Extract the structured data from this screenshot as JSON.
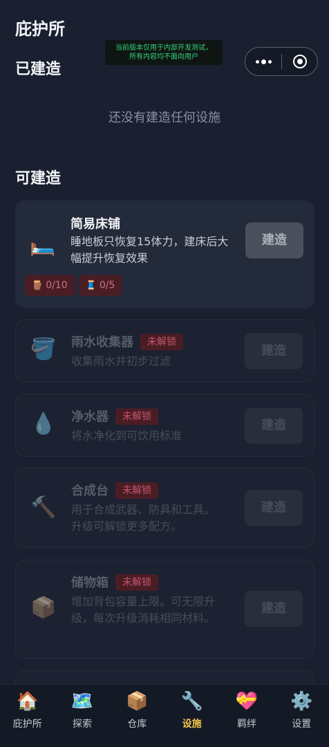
{
  "header": {
    "title": "庇护所"
  },
  "notice": {
    "line1": "当前版本仅用于内部开发测试，",
    "line2": "所有内容均不面向用户"
  },
  "capsule": {
    "more_icon": "more-dots-icon",
    "close_icon": "target-circle-icon"
  },
  "built": {
    "title": "已建造",
    "empty_text": "还没有建造任何设施"
  },
  "buildable": {
    "title": "可建造",
    "build_label": "建造",
    "locked_label": "未解锁",
    "items": [
      {
        "icon": "🛏️",
        "icon_name": "bed-icon",
        "name": "简易床铺",
        "desc": "睡地板只恢复15体力，建床后大幅提升恢复效果",
        "locked": false,
        "materials": [
          {
            "icon": "🪵",
            "icon_name": "wood-icon",
            "text": "0/10"
          },
          {
            "icon": "🧵",
            "icon_name": "thread-icon",
            "text": "0/5"
          }
        ]
      },
      {
        "icon": "🪣",
        "icon_name": "bucket-icon",
        "name": "雨水收集器",
        "desc": "收集雨水并初步过滤",
        "locked": true
      },
      {
        "icon": "💧",
        "icon_name": "water-drop-icon",
        "name": "净水器",
        "desc": "将水净化到可饮用标准",
        "locked": true
      },
      {
        "icon": "🔨",
        "icon_name": "hammer-icon",
        "name": "合成台",
        "desc": "用于合成武器、防具和工具。升级可解锁更多配方。",
        "locked": true
      },
      {
        "icon": "📦",
        "icon_name": "box-icon",
        "name": "储物箱",
        "desc": "增加背包容量上限。可无限升级，每次升级消耗相同材料。",
        "locked": true
      }
    ]
  },
  "tabs": [
    {
      "icon": "🏠",
      "icon_name": "house-icon",
      "label": "庇护所"
    },
    {
      "icon": "🗺️",
      "icon_name": "map-icon",
      "label": "探索"
    },
    {
      "icon": "📦",
      "icon_name": "package-icon",
      "label": "仓库"
    },
    {
      "icon": "🔧",
      "icon_name": "wrench-icon",
      "label": "设施",
      "selected": true
    },
    {
      "icon": "💝",
      "icon_name": "heart-ribbon-icon",
      "label": "羁绊"
    },
    {
      "icon": "⚙️",
      "icon_name": "gear-icon",
      "label": "设置"
    }
  ]
}
